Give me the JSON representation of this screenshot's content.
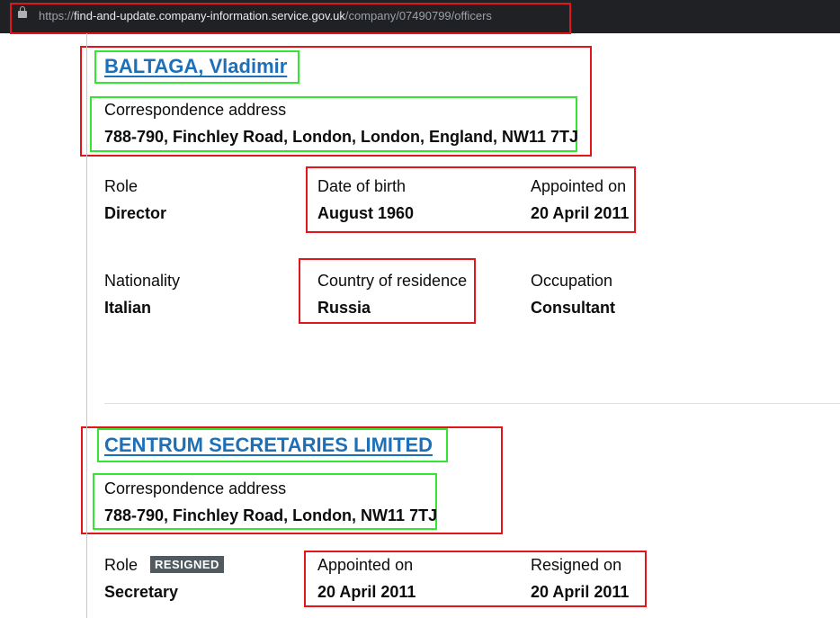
{
  "browser": {
    "url_scheme": "https://",
    "url_host": "find-and-update.company-information.service.gov.uk",
    "url_path": "/company/07490799/officers"
  },
  "officers": [
    {
      "name": "BALTAGA, Vladimir",
      "address_label": "Correspondence address",
      "address": "788-790, Finchley Road, London, London, England, NW11 7TJ",
      "role_label": "Role",
      "role": "Director",
      "dob_label": "Date of birth",
      "dob": "August 1960",
      "appointed_label": "Appointed on",
      "appointed": "20 April 2011",
      "nationality_label": "Nationality",
      "nationality": "Italian",
      "residence_label": "Country of residence",
      "residence": "Russia",
      "occupation_label": "Occupation",
      "occupation": "Consultant"
    },
    {
      "name": "CENTRUM SECRETARIES LIMITED",
      "address_label": "Correspondence address",
      "address": "788-790, Finchley Road, London, NW11 7TJ",
      "role_label": "Role",
      "status_tag": "RESIGNED",
      "role": "Secretary",
      "appointed_label": "Appointed on",
      "appointed": "20 April 2011",
      "resigned_label": "Resigned on",
      "resigned": "20 April 2011"
    }
  ],
  "colors": {
    "link": "#1d70b8",
    "highlight_red": "#e3151b",
    "highlight_green": "#32e632",
    "tag_bg": "#505a5f"
  }
}
